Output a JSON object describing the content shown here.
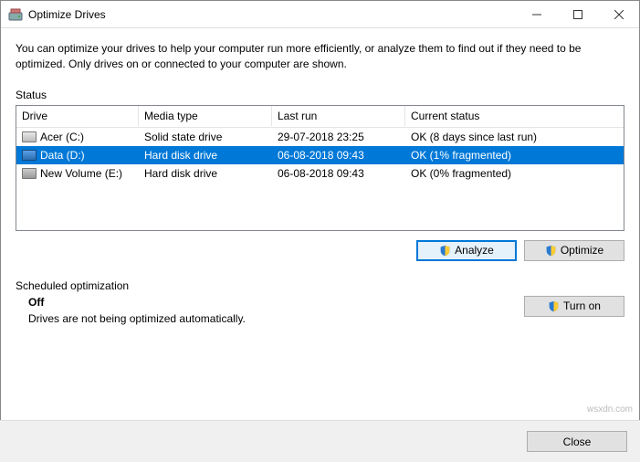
{
  "window_title": "Optimize Drives",
  "description": "You can optimize your drives to help your computer run more efficiently, or analyze them to find out if they need to be optimized. Only drives on or connected to your computer are shown.",
  "status_label": "Status",
  "columns": {
    "drive": "Drive",
    "media": "Media type",
    "last_run": "Last run",
    "status": "Current status"
  },
  "rows": [
    {
      "drive": "Acer (C:)",
      "media": "Solid state drive",
      "last_run": "29-07-2018 23:25",
      "status": "OK (8 days since last run)",
      "selected": false,
      "icon": "ssd"
    },
    {
      "drive": "Data (D:)",
      "media": "Hard disk drive",
      "last_run": "06-08-2018 09:43",
      "status": "OK (1% fragmented)",
      "selected": true,
      "icon": "hdd"
    },
    {
      "drive": "New Volume (E:)",
      "media": "Hard disk drive",
      "last_run": "06-08-2018 09:43",
      "status": "OK (0% fragmented)",
      "selected": false,
      "icon": "hdd"
    }
  ],
  "buttons": {
    "analyze": "Analyze",
    "optimize": "Optimize",
    "turnon": "Turn on",
    "close": "Close"
  },
  "scheduled_label": "Scheduled optimization",
  "scheduled_state": "Off",
  "scheduled_desc": "Drives are not being optimized automatically.",
  "watermark": "wsxdn.com"
}
